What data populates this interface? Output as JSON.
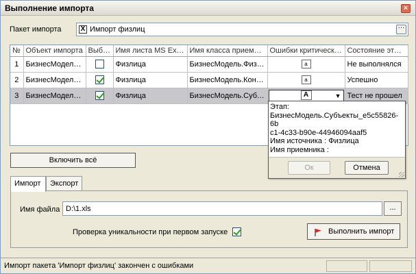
{
  "window": {
    "title": "Выполнение импорта",
    "close_glyph": "×"
  },
  "package": {
    "label": "Пакет импорта",
    "value": "Импорт физлиц",
    "browse_glyph": "···"
  },
  "table": {
    "columns": [
      "№",
      "Объект импорта",
      "Выбран",
      "Имя листа MS Excel",
      "Имя класса приемника",
      "Ошибки критические",
      "Состояние этапа"
    ],
    "rows": [
      {
        "num": "1",
        "object": "БизнесМодель.Физлица",
        "selected": false,
        "sheet": "Физлица",
        "class": "БизнесМодель.Физлица",
        "errors_icon": "a",
        "state": "Не выполнялся"
      },
      {
        "num": "2",
        "object": "БизнесМодель.Контрагенты",
        "selected": true,
        "sheet": "Физлица",
        "class": "БизнесМодель.Контрагенты",
        "errors_icon": "a",
        "state": "Успешно"
      },
      {
        "num": "3",
        "object": "БизнесМодель.Субъекты",
        "selected": true,
        "sheet": "Физлица",
        "class": "БизнесМодель.Субъекты",
        "errors_icon": "A",
        "state": "Тест не прошел"
      }
    ]
  },
  "popup": {
    "lines": [
      "Этап:",
      "БизнесМодель.Субъекты_e5c55826-6b",
      "c1-4c33-b90e-44946094aaf5",
      "Имя источника : Физлица",
      "Имя приемника :"
    ],
    "ok_label": "Ок",
    "cancel_label": "Отмена"
  },
  "include_all_label": "Включить всё",
  "tabs": [
    {
      "label": "Импорт",
      "active": true
    },
    {
      "label": "Экспорт",
      "active": false
    }
  ],
  "import_tab": {
    "file_label": "Имя файла",
    "file_value": "D:\\1.xls",
    "browse_label": "...",
    "uniqueness_label": "Проверка уникальности при первом запуске",
    "uniqueness_checked": true,
    "run_label": "Выполнить импорт"
  },
  "status": {
    "text": "Импорт пакета 'Импорт физлиц' закончен с ошибками"
  },
  "colors": {
    "selected_row": "#c8c8cc",
    "check_green": "#21a121",
    "flag_red": "#d42a2a"
  }
}
